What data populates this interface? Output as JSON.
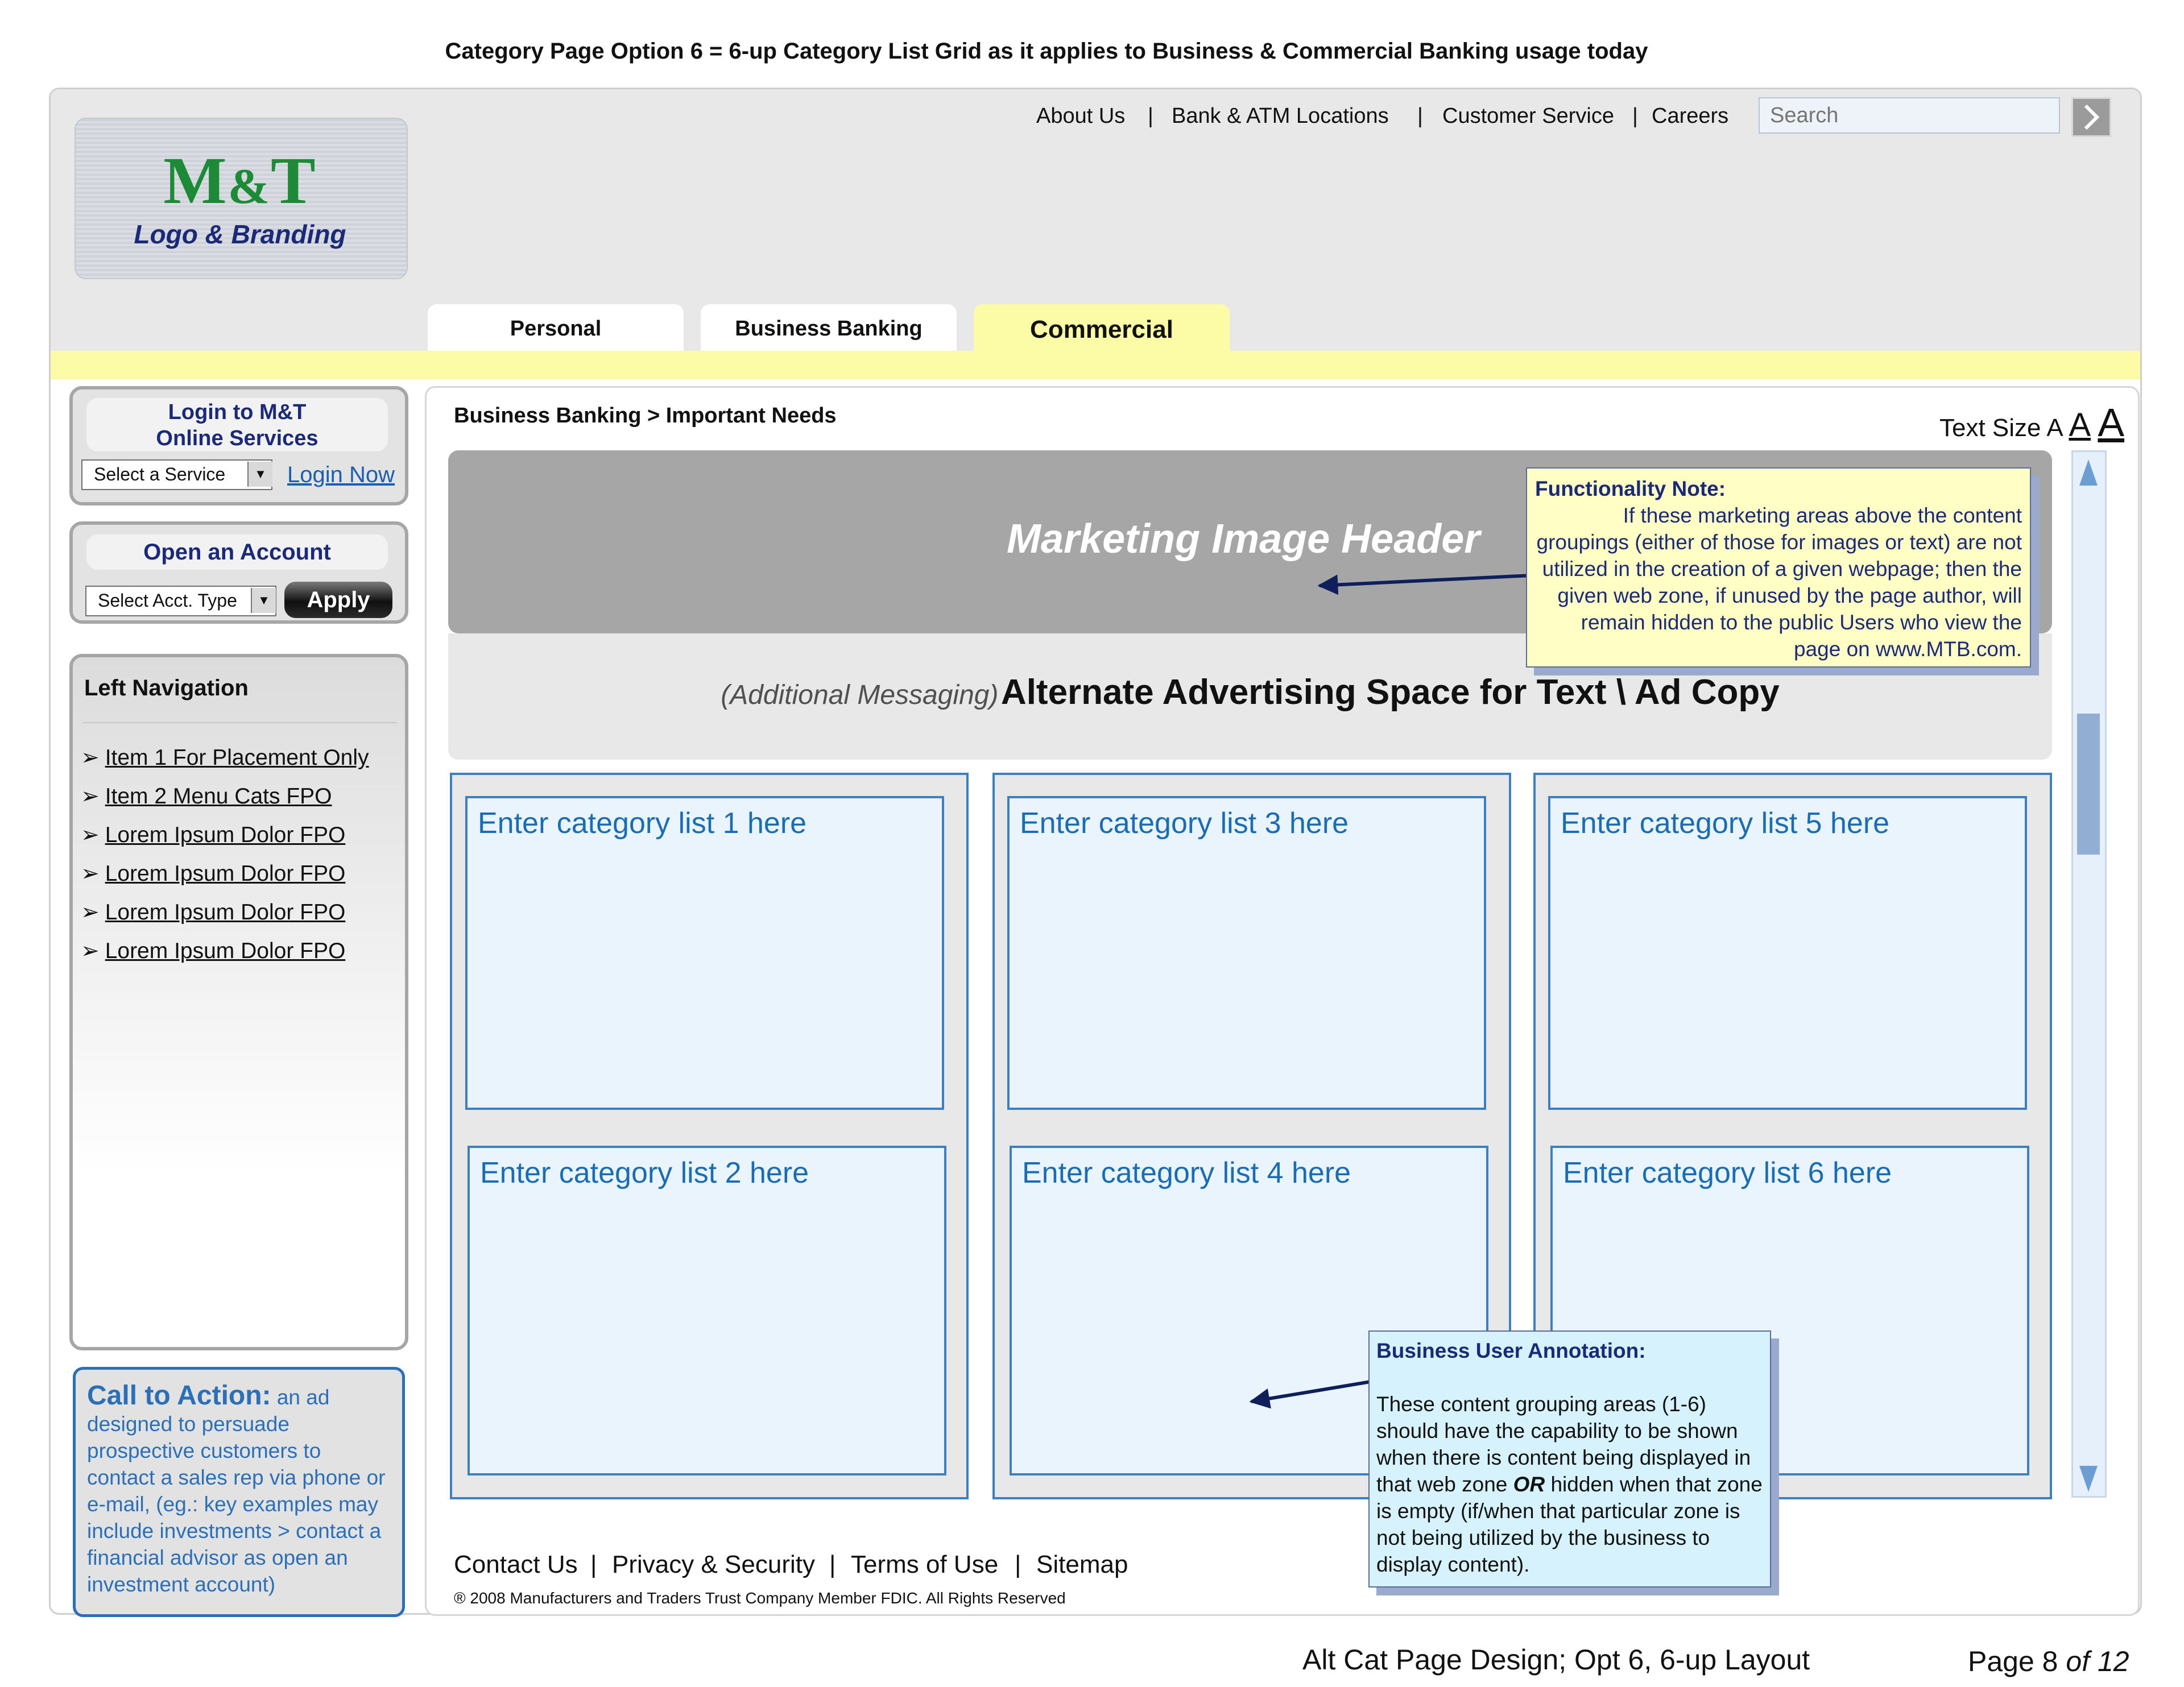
{
  "page_title": "Category Page Option 6 = 6-up Category List Grid as it applies to Business & Commercial Banking usage today",
  "logo": {
    "mark_m": "M",
    "mark_amp": "&",
    "mark_t": "T",
    "caption": "Logo & Branding"
  },
  "top_links": [
    "About Us",
    "Bank & ATM Locations",
    "Customer Service",
    "Careers"
  ],
  "separator": "|",
  "search": {
    "placeholder": "Search"
  },
  "tabs": [
    {
      "label": "Personal"
    },
    {
      "label": "Business Banking"
    },
    {
      "label": "Commercial"
    }
  ],
  "login": {
    "title_line1": "Login to M&T",
    "title_line2": "Online Services",
    "select_value": "Select a Service",
    "link": "Login Now"
  },
  "account": {
    "title": "Open an Account",
    "select_value": "Select Acct. Type",
    "apply": "Apply"
  },
  "left_nav": {
    "title": "Left Navigation",
    "items": [
      "Item 1 For Placement Only",
      "Item 2 Menu Cats FPO",
      "Lorem Ipsum Dolor FPO",
      "Lorem Ipsum Dolor FPO",
      "Lorem Ipsum Dolor FPO",
      "Lorem Ipsum Dolor FPO"
    ]
  },
  "cta": {
    "title": "Call to Action:",
    "body": "an ad designed to persuade prospective customers to contact a sales rep via phone or e-mail, (eg.: key examples may include   investments > contact a financial advisor as open an investment account)"
  },
  "breadcrumb": "Business Banking  > Important Needs",
  "text_size": {
    "label": "Text Size",
    "small": "A",
    "medium": "A",
    "large": "A"
  },
  "marketing_header": "Marketing Image Header",
  "ad_space": {
    "prefix": "(Additional Messaging)",
    "main": "Alternate Advertising Space for Text \\ Ad Copy"
  },
  "categories": [
    "Enter category list 1 here",
    "Enter category list 2 here",
    "Enter category list 3 here",
    "Enter category list 4 here",
    "Enter category list 5 here",
    "Enter category list 6 here"
  ],
  "functionality_note": {
    "title": "Functionality Note:",
    "body": "If these marketing areas above the content groupings (either of those for images or text) are not utilized in the creation of a given webpage; then the given web zone, if unused by the page author, will remain hidden to the public Users who view the page on www.MTB.com."
  },
  "business_note": {
    "title": "Business User Annotation:",
    "body_before": "These content grouping areas (1-6) should have the capability to be shown when there is content being displayed in that web zone ",
    "body_emph": "OR",
    "body_after": " hidden when that zone is empty (if/when that particular zone is not being utilized by the business to display content)."
  },
  "footer": {
    "links": [
      "Contact Us",
      "Privacy & Security",
      "Terms of Use",
      "Sitemap"
    ],
    "copyright": "® 2008 Manufacturers and Traders Trust Company Member FDIC. All Rights Reserved"
  },
  "doc_caption": "Alt Cat Page Design; Opt 6, 6-up Layout",
  "page_number": {
    "prefix": "Page 8",
    "suffix": "of 12"
  },
  "colors": {
    "accent_yellow": "#fdfca6",
    "link_blue": "#1a5fb4",
    "category_blue": "#1a6db5",
    "brand_green": "#1c8a37",
    "brand_navy": "#1b2a78"
  }
}
